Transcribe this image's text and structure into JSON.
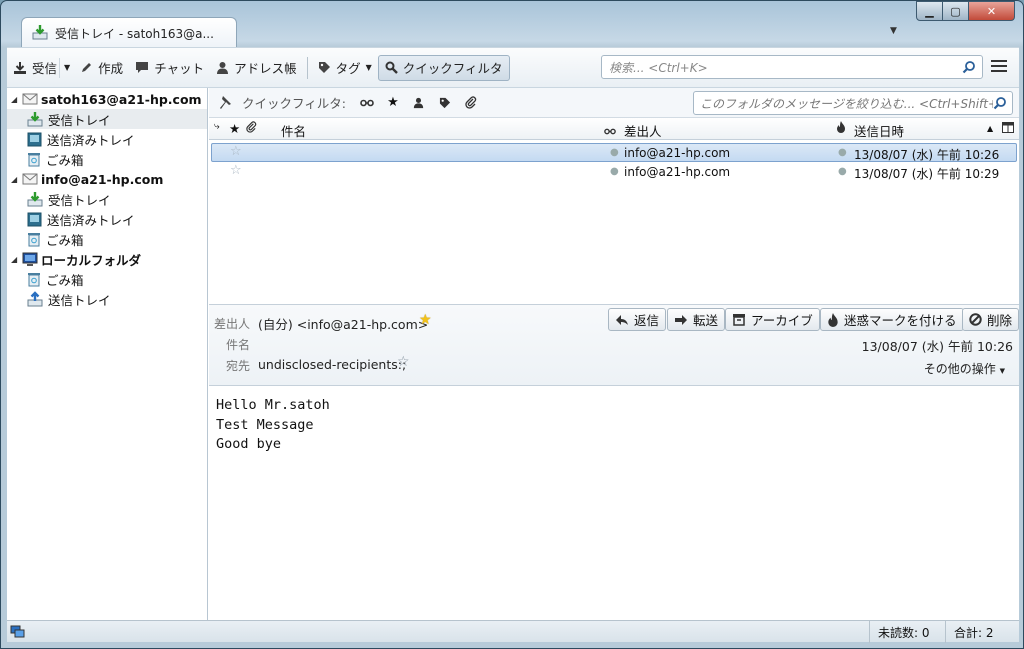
{
  "window": {
    "tab_title": "受信トレイ - satoh163@a..."
  },
  "toolbar": {
    "get_mail": "受信",
    "write": "作成",
    "chat": "チャット",
    "address_book": "アドレス帳",
    "tag": "タグ",
    "quick_filter": "クイックフィルタ",
    "search_placeholder": "検索... <Ctrl+K>"
  },
  "sidebar": {
    "accounts": [
      {
        "name": "satoh163@a21-hp.com",
        "folders": [
          "受信トレイ",
          "送信済みトレイ",
          "ごみ箱"
        ]
      },
      {
        "name": "info@a21-hp.com",
        "folders": [
          "受信トレイ",
          "送信済みトレイ",
          "ごみ箱"
        ]
      },
      {
        "name": "ローカルフォルダ",
        "folders": [
          "ごみ箱",
          "送信トレイ"
        ]
      }
    ],
    "selected_folder": "受信トレイ"
  },
  "quickfilter": {
    "label": "クイックフィルタ:",
    "filter_placeholder": "このフォルダのメッセージを絞り込む... <Ctrl+Shift+"
  },
  "columns": {
    "subject": "件名",
    "from": "差出人",
    "date": "送信日時"
  },
  "messages": [
    {
      "subject": "",
      "from": "info@a21-hp.com",
      "date": "13/08/07 (水) 午前 10:26",
      "selected": true
    },
    {
      "subject": "",
      "from": "info@a21-hp.com",
      "date": "13/08/07 (水) 午前 10:29",
      "selected": false
    }
  ],
  "header": {
    "from_label": "差出人",
    "from_value": "(自分) <info@a21-hp.com>",
    "subject_label": "件名",
    "to_label": "宛先",
    "to_value": "undisclosed-recipients:;",
    "date": "13/08/07 (水) 午前 10:26",
    "other_actions": "その他の操作",
    "buttons": {
      "reply": "返信",
      "forward": "転送",
      "archive": "アーカイブ",
      "junk": "迷惑マークを付ける",
      "delete": "削除"
    }
  },
  "body_lines": [
    "Hello Mr.satoh",
    "Test Message",
    "Good bye"
  ],
  "status": {
    "unread": "未読数: 0",
    "total": "合計: 2"
  },
  "colors": {
    "accent": "#5b8fd4",
    "selection": "#c4daf2",
    "star": "#f2c21a"
  }
}
